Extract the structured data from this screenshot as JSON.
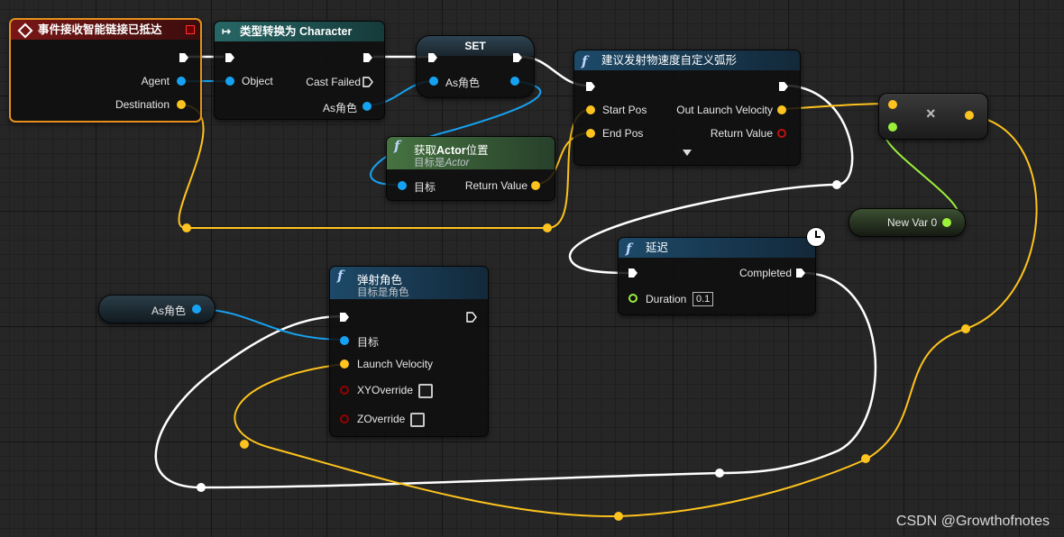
{
  "colors": {
    "exec": "#ffffff",
    "object_pin": "#16a2f2",
    "vector_pin": "#fdc31e",
    "bool_pin": "#960000",
    "float_pin": "#9bf03c",
    "event_header": "#7a1616",
    "cast_header": "#276766",
    "func_header": "#1d4a69",
    "pure_header": "#467341",
    "selection": "#e6901c"
  },
  "event_node": {
    "icon": "event-diamond-icon",
    "title": "事件接收智能链接已抵达",
    "pins": {
      "agent": "Agent",
      "destination": "Destination"
    }
  },
  "cast_node": {
    "icon": "cast-arrow-icon",
    "title": "类型转换为 Character",
    "pins": {
      "object": "Object",
      "cast_failed": "Cast Failed",
      "as_char": "As角色"
    }
  },
  "set_node": {
    "title": "SET",
    "pins": {
      "value": "As角色"
    }
  },
  "arc_node": {
    "icon": "function-icon",
    "title": "建议发射物速度自定义弧形",
    "pins": {
      "start_pos": "Start Pos",
      "end_pos": "End Pos",
      "out_launch_velocity": "Out Launch Velocity",
      "return_value": "Return Value"
    },
    "expand_icon": "expand-arrow-icon"
  },
  "get_actor_node": {
    "icon": "function-icon",
    "title_prefix": "获取",
    "title_bold": "Actor",
    "title_suffix": "位置",
    "subtitle_prefix": "目标是",
    "subtitle_italic": "Actor",
    "pins": {
      "target": "目标",
      "return_value": "Return Value"
    }
  },
  "multiply_node": {
    "symbol": "×"
  },
  "new_var_node": {
    "label": "New Var 0"
  },
  "delay_node": {
    "icon": "function-icon",
    "title": "延迟",
    "latent_icon": "clock-icon",
    "pins": {
      "completed": "Completed",
      "duration": "Duration",
      "duration_value": "0.1"
    }
  },
  "as_char_getter": {
    "label": "As角色"
  },
  "launch_node": {
    "icon": "function-icon",
    "title": "弹射角色",
    "subtitle": "目标是角色",
    "pins": {
      "target": "目标",
      "launch_velocity": "Launch Velocity",
      "xy_override": "XYOverride",
      "z_override": "ZOverride"
    }
  },
  "watermark": "CSDN @Growthofnotes"
}
